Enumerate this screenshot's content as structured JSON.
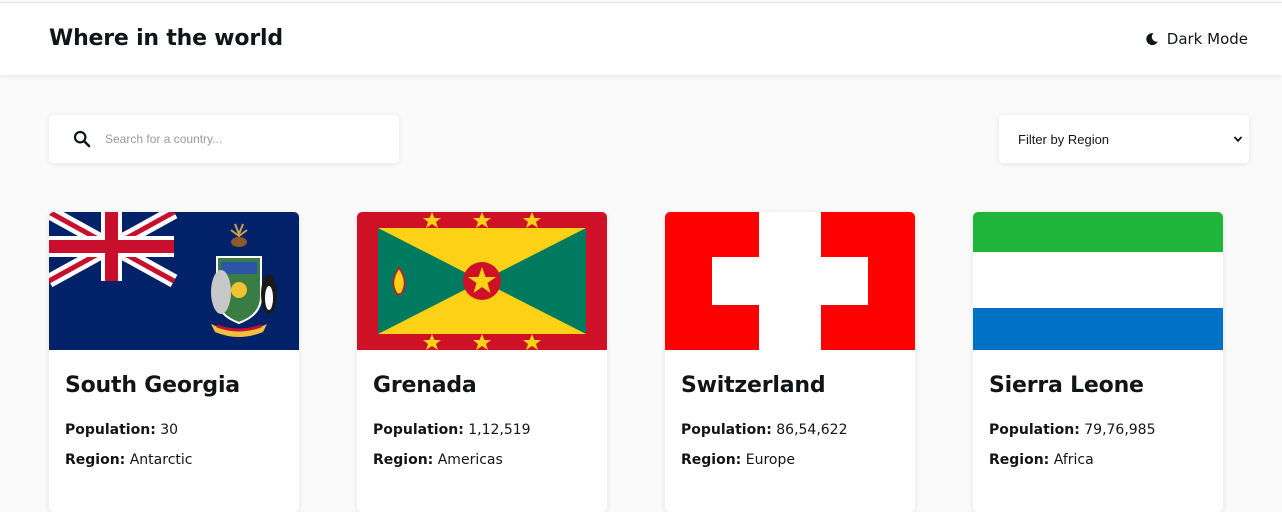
{
  "header": {
    "title": "Where in the world",
    "mode_label": "Dark Mode"
  },
  "search": {
    "placeholder": "Search for a country...",
    "value": ""
  },
  "filter": {
    "selected": "Filter by Region"
  },
  "labels": {
    "population": "Population:",
    "region": "Region:"
  },
  "countries": [
    {
      "name": "South Georgia",
      "population": "30",
      "region": "Antarctic",
      "flag": "south-georgia-flag-icon"
    },
    {
      "name": "Grenada",
      "population": "1,12,519",
      "region": "Americas",
      "flag": "grenada-flag-icon"
    },
    {
      "name": "Switzerland",
      "population": "86,54,622",
      "region": "Europe",
      "flag": "switzerland-flag-icon"
    },
    {
      "name": "Sierra Leone",
      "population": "79,76,985",
      "region": "Africa",
      "flag": "sierra-leone-flag-icon"
    }
  ],
  "colors": {
    "background": "#fafafa",
    "element": "#ffffff",
    "text": "#111517"
  }
}
